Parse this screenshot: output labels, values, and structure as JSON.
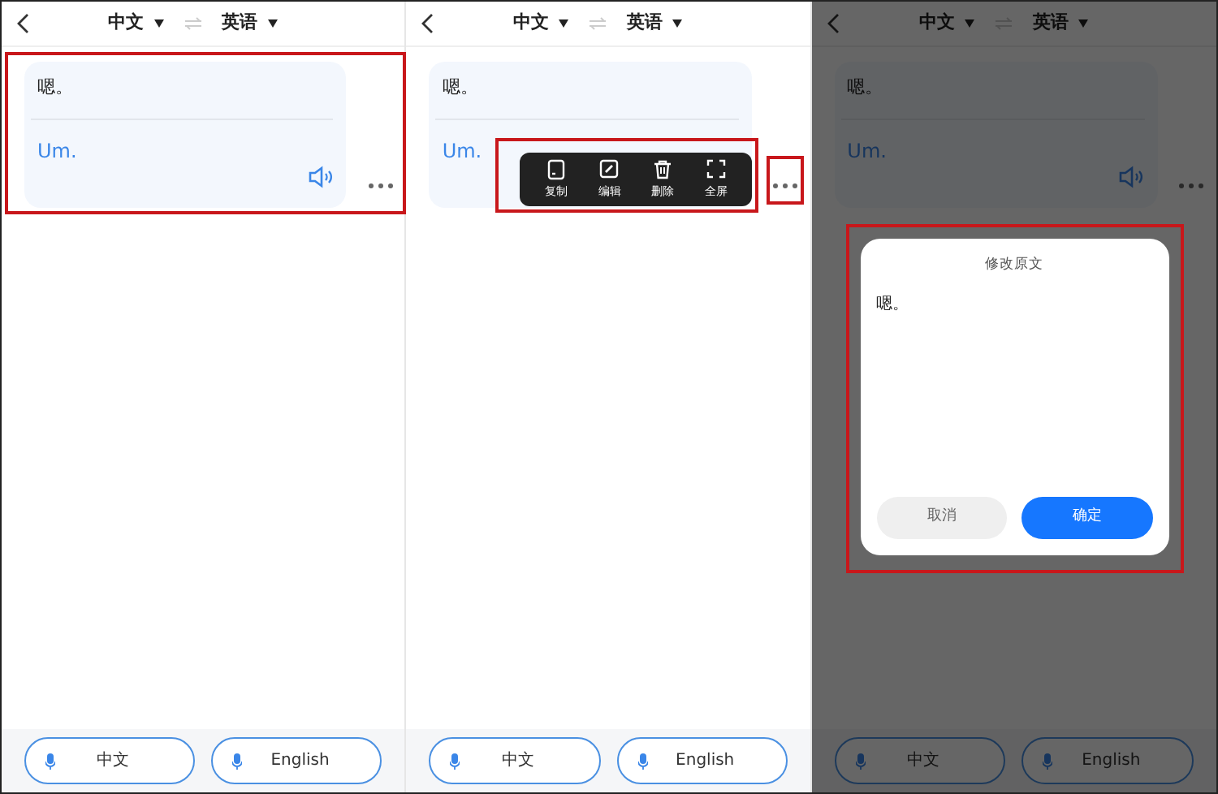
{
  "panels": [
    {
      "kind": "plain",
      "source_lang": "中文",
      "target_lang": "英语",
      "source_text": "嗯。",
      "translation": "Um.",
      "card_highlighted": true,
      "mic_buttons": [
        {
          "label": "中文"
        },
        {
          "label": "English"
        }
      ]
    },
    {
      "kind": "menu",
      "source_lang": "中文",
      "target_lang": "英语",
      "source_text": "嗯。",
      "translation": "Um.",
      "menu": {
        "highlighted": true,
        "more_highlighted": true,
        "items": [
          {
            "kind": "copy",
            "label": "复制"
          },
          {
            "kind": "edit",
            "label": "编辑"
          },
          {
            "kind": "delete",
            "label": "删除"
          },
          {
            "kind": "fullscreen",
            "label": "全屏"
          }
        ]
      },
      "mic_buttons": [
        {
          "label": "中文"
        },
        {
          "label": "English"
        }
      ]
    },
    {
      "kind": "dialog",
      "source_lang": "中文",
      "target_lang": "英语",
      "source_text": "嗯。",
      "translation": "Um.",
      "dialog": {
        "highlighted": true,
        "title": "修改原文",
        "text": "嗯。",
        "buttons": [
          {
            "kind": "secondary",
            "label": "取消"
          },
          {
            "kind": "primary",
            "label": "确定"
          }
        ]
      },
      "mic_buttons": [
        {
          "label": "中文"
        },
        {
          "label": "English"
        }
      ]
    }
  ]
}
